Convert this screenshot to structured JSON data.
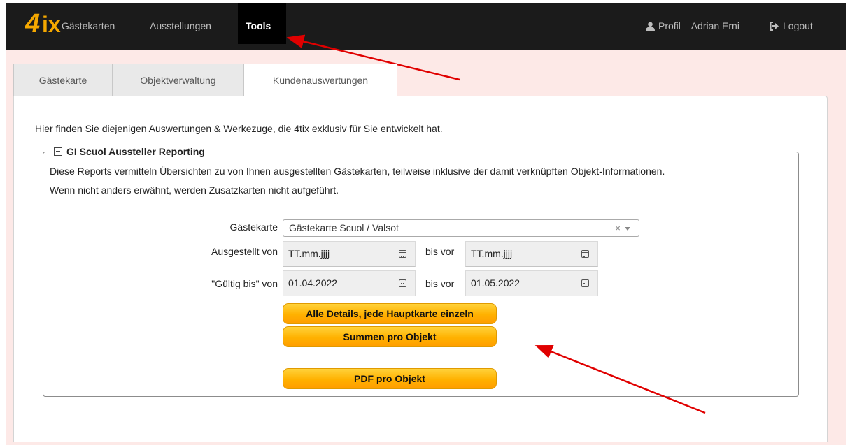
{
  "nav": {
    "logo": "4tix",
    "items": [
      "Gästekarten",
      "Ausstellungen"
    ],
    "active": "Tools",
    "profile": "Profil – Adrian Erni",
    "logout": "Logout"
  },
  "tabs": [
    "Gästekarte",
    "Objektverwaltung",
    "Kundenauswertungen"
  ],
  "intro": "Hier finden Sie diejenigen Auswertungen & Werkezuge, die 4tix exklusiv für Sie entwickelt hat.",
  "section": {
    "title": "GI Scuol Aussteller Reporting",
    "desc1": "Diese Reports vermitteln Übersichten zu von Ihnen ausgestellten Gästekarten, teilweise inklusive der damit verknüpften Objekt-Informationen.",
    "desc2": "Wenn nicht anders erwähnt, werden Zusatzkarten nicht aufgeführt."
  },
  "form": {
    "gaestekarte_label": "Gästekarte",
    "gaestekarte_value": "Gästekarte Scuol / Valsot",
    "clear": "×",
    "ausgestellt_label": "Ausgestellt von",
    "ausgestellt_from": "TT.mm.jjjj",
    "bis_vor": "bis vor",
    "ausgestellt_to": "TT.mm.jjjj",
    "gueltig_label": "\"Gültig bis\" von",
    "gueltig_from": "01.04.2022",
    "gueltig_to": "01.05.2022"
  },
  "buttons": {
    "details": "Alle Details, jede Hauptkarte einzeln",
    "summen": "Summen pro Objekt",
    "pdf": "PDF pro Objekt"
  },
  "colors": {
    "navbar": "#1b1b1b",
    "page_bg": "#fde9e7",
    "button": "#ffb100",
    "annotation_arrow": "#e00000"
  }
}
